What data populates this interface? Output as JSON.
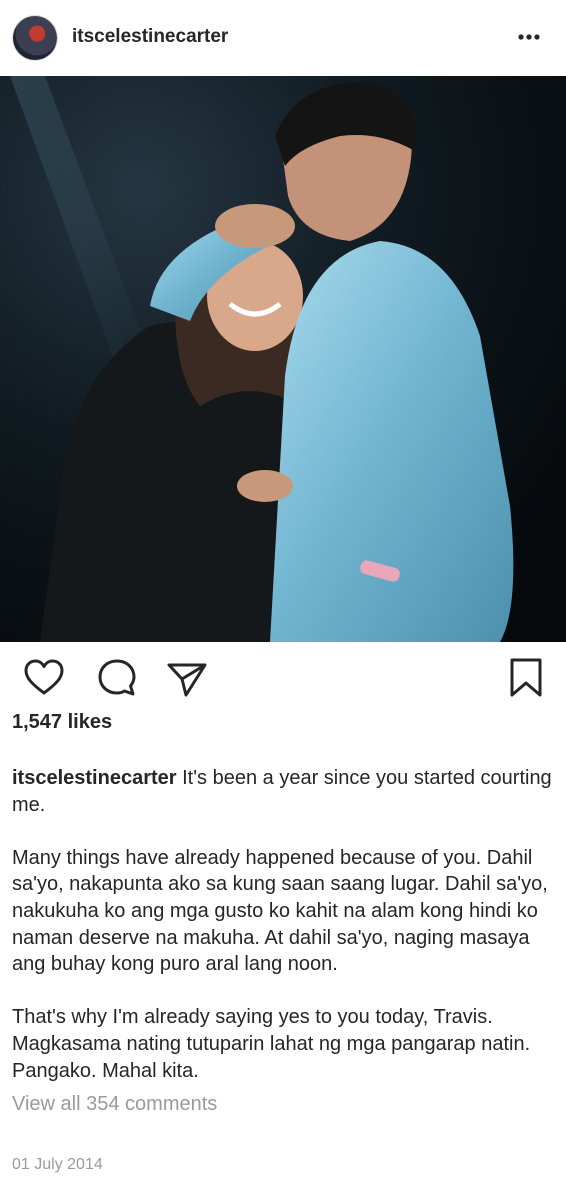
{
  "post": {
    "username": "itscelestinecarter",
    "likes": "1,547 likes",
    "caption_user": "itscelestinecarter",
    "caption_lines": [
      " It's been a year since you started courting me.",
      "",
      "Many things have already happened because of you. Dahil sa'yo, nakapunta ako sa kung saan saang lugar. Dahil sa'yo, nakukuha ko ang mga gusto ko kahit na alam kong hindi ko naman deserve na makuha. At dahil sa'yo, naging masaya ang buhay kong puro aral lang noon.",
      "",
      "That's why I'm already saying yes to you today, Travis. Magkasama nating tutuparin lahat ng mga pangarap natin. Pangako. Mahal kita."
    ],
    "view_comments": "View all 354 comments",
    "date": "01 July 2014"
  },
  "icons": {
    "more": "more-options-icon",
    "like": "heart-icon",
    "comment": "comment-bubble-icon",
    "share": "paper-plane-icon",
    "save": "bookmark-icon"
  },
  "colors": {
    "text": "#262626",
    "muted": "#9a9a9a",
    "jacket": "#7bbcd6",
    "photo_bg": "#0b1217"
  }
}
